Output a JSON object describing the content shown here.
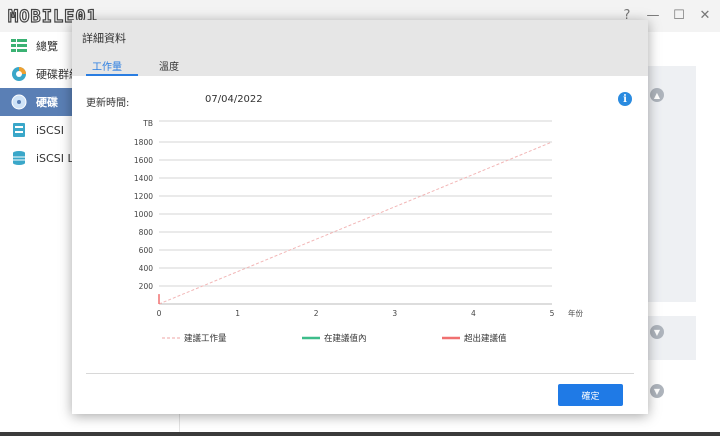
{
  "app": {
    "logo": "MOBILE01",
    "window_controls": [
      "?",
      "—",
      "☐",
      "✕"
    ]
  },
  "sidebar": {
    "items": [
      {
        "label": "總覽",
        "icon": "overview-icon",
        "active": false,
        "color": "#3bb273"
      },
      {
        "label": "硬碟群組",
        "icon": "pie-chart-icon",
        "active": false,
        "color": "#f0a030"
      },
      {
        "label": "硬碟",
        "icon": "drive-icon",
        "active": true,
        "color": "#5a7fb5"
      },
      {
        "label": "iSCSI",
        "icon": "iscsi-icon",
        "active": false,
        "color": "#3aa7c9"
      },
      {
        "label": "iSCSI LUN",
        "icon": "database-icon",
        "active": false,
        "color": "#3aa7c9"
      }
    ]
  },
  "dialog": {
    "title": "詳細資料",
    "tabs": [
      {
        "label": "工作量",
        "active": true
      },
      {
        "label": "溫度",
        "active": false
      }
    ],
    "update_time_label": "更新時間:",
    "update_time_value": "07/04/2022",
    "ok_label": "確定"
  },
  "chart_data": {
    "type": "line",
    "ylabel": "TB",
    "xlabel": "年份",
    "xlim": [
      0,
      5
    ],
    "ylim": [
      0,
      1800
    ],
    "x_ticks": [
      0,
      1,
      2,
      3,
      4,
      5
    ],
    "y_ticks": [
      200,
      400,
      600,
      800,
      1000,
      1200,
      1400,
      1600,
      1800
    ],
    "series": [
      {
        "name": "建議工作量",
        "color": "#f2b6b6",
        "style": "dashed",
        "points": [
          [
            0,
            0
          ],
          [
            5,
            1800
          ]
        ]
      },
      {
        "name": "在建議值內",
        "color": "#3dbd8a",
        "style": "solid",
        "points": []
      },
      {
        "name": "超出建議值",
        "color": "#f07070",
        "style": "solid",
        "points": [
          [
            0,
            0
          ],
          [
            0,
            110
          ]
        ]
      }
    ]
  },
  "colors": {
    "accent": "#2a7de1",
    "button": "#1f7ae6",
    "sidebar_active": "#5a7fb5"
  }
}
